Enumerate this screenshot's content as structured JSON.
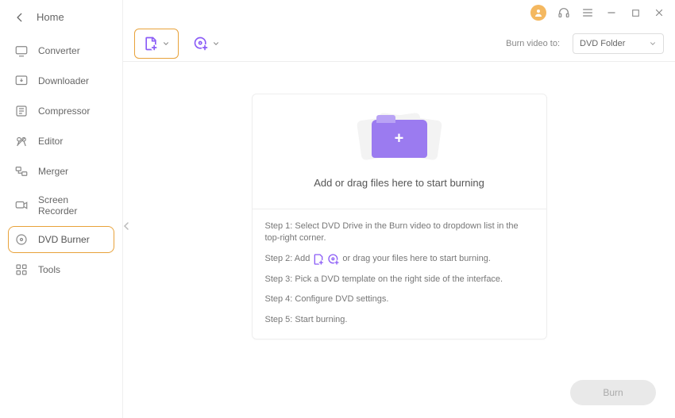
{
  "sidebar": {
    "title": "Home",
    "items": [
      {
        "label": "Converter"
      },
      {
        "label": "Downloader"
      },
      {
        "label": "Compressor"
      },
      {
        "label": "Editor"
      },
      {
        "label": "Merger"
      },
      {
        "label": "Screen Recorder"
      },
      {
        "label": "DVD Burner"
      },
      {
        "label": "Tools"
      }
    ]
  },
  "toolbar": {
    "burn_to_label": "Burn video to:",
    "burn_to_value": "DVD Folder"
  },
  "drop": {
    "title": "Add or drag files here to start burning"
  },
  "steps": {
    "s1": "Step 1: Select DVD Drive in the Burn video to dropdown list in the top-right corner.",
    "s2a": "Step 2: Add",
    "s2b": "or drag your files here to start burning.",
    "s3": "Step 3: Pick a DVD template on the right side of the interface.",
    "s4": "Step 4: Configure DVD settings.",
    "s5": "Step 5: Start burning."
  },
  "footer": {
    "burn_label": "Burn"
  }
}
